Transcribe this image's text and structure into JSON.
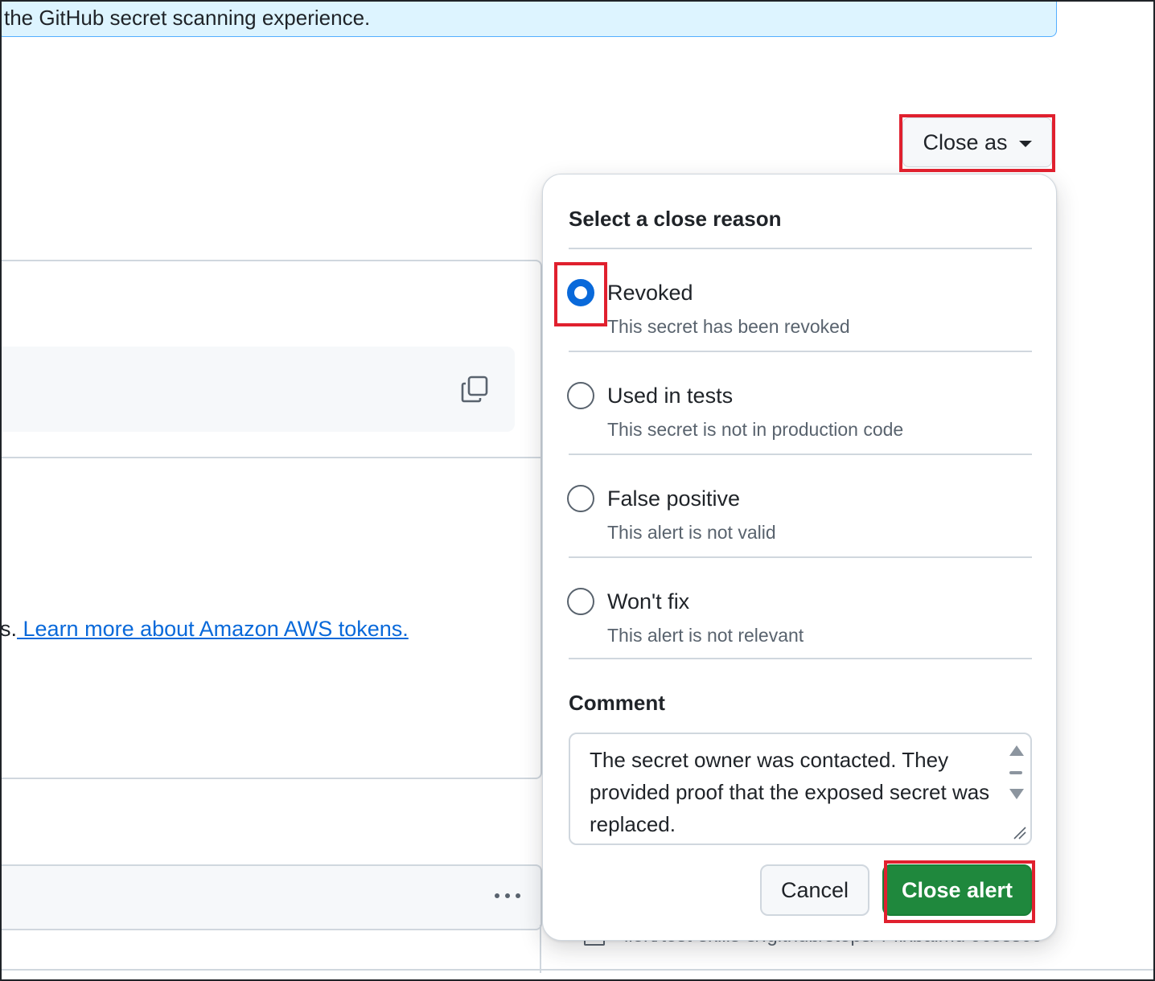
{
  "banner": {
    "text": "the GitHub secret scanning experience."
  },
  "header": {
    "close_as_label": "Close as"
  },
  "secret": {
    "learn_prefix": "s.",
    "learn_link": " Learn more about Amazon AWS tokens."
  },
  "location": {
    "path_text": "ilert/test-skills-s/.github/steps/4-fixbaimd  9c5ss09"
  },
  "dialog": {
    "title": "Select a close reason",
    "options": [
      {
        "label": "Revoked",
        "description": "This secret has been revoked",
        "checked": true
      },
      {
        "label": "Used in tests",
        "description": "This secret is not in production code",
        "checked": false
      },
      {
        "label": "False positive",
        "description": "This alert is not valid",
        "checked": false
      },
      {
        "label": "Won't fix",
        "description": "This alert is not relevant",
        "checked": false
      }
    ],
    "comment_label": "Comment",
    "comment_value": "The secret owner was contacted. They provided proof that the exposed secret was replaced.",
    "cancel_label": "Cancel",
    "close_alert_label": "Close alert"
  },
  "colors": {
    "accent": "#0969da",
    "primary_button": "#1f883d",
    "highlight": "#e0202e",
    "banner_bg": "#ddf4ff"
  }
}
